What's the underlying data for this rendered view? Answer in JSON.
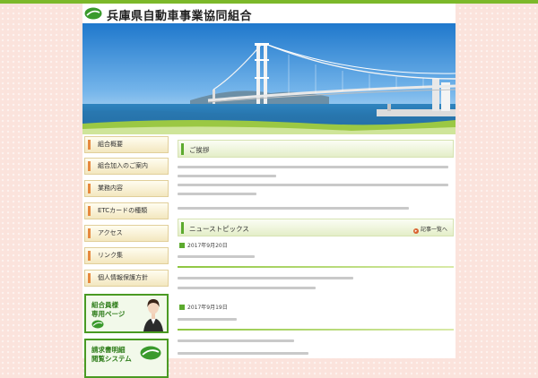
{
  "site": {
    "title": "兵庫県自動車事業協同組合"
  },
  "nav": {
    "items": [
      {
        "label": "組合概要"
      },
      {
        "label": "組合加入のご案内"
      },
      {
        "label": "業務内容"
      },
      {
        "label": "ETCカードの種類"
      },
      {
        "label": "アクセス"
      },
      {
        "label": "リンク集"
      },
      {
        "label": "個人情報保護方針"
      }
    ]
  },
  "banners": {
    "members": {
      "line1": "組合員様",
      "line2": "専用ページ"
    },
    "invoice": {
      "line1": "請求書明細",
      "line2": "閲覧システム"
    }
  },
  "greeting": {
    "title": "ご挨拶"
  },
  "news": {
    "title": "ニューストピックス",
    "more_label": "記事一覧へ",
    "items": [
      {
        "date": "2017年9月20日"
      },
      {
        "date": "2017年9月19日"
      }
    ]
  },
  "colors": {
    "accent_green": "#5caa2e",
    "nav_marker": "#e6893e",
    "background": "#fbe3dc"
  },
  "icons": {
    "logo": "logo-icon",
    "calendar": "calendar-icon",
    "arrow": "arrow-icon"
  }
}
